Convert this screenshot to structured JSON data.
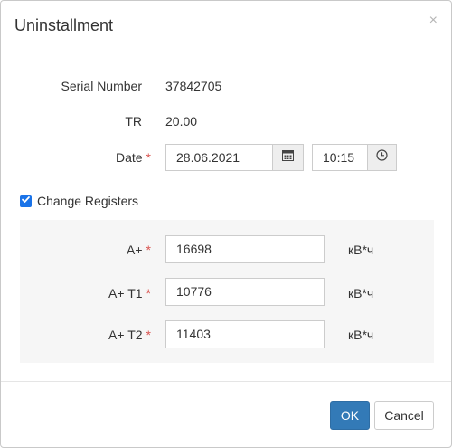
{
  "dialog": {
    "title": "Uninstallment",
    "close_glyph": "×"
  },
  "fields": {
    "serial_label": "Serial Number",
    "serial_value": "37842705",
    "tr_label": "TR",
    "tr_value": "20.00",
    "date_label": "Date",
    "date_value": "28.06.2021",
    "time_value": "10:15",
    "required_mark": "*"
  },
  "registers": {
    "checkbox_label": "Change Registers",
    "checked": true,
    "rows": [
      {
        "label": "A+",
        "value": "16698",
        "unit": "кВ*ч"
      },
      {
        "label": "A+ T1",
        "value": "10776",
        "unit": "кВ*ч"
      },
      {
        "label": "A+ T2",
        "value": "11403",
        "unit": "кВ*ч"
      }
    ]
  },
  "footer": {
    "ok_label": "OK",
    "cancel_label": "Cancel"
  },
  "colors": {
    "primary": "#337ab7",
    "required": "#d9534f",
    "checkbox": "#1a73e8"
  },
  "icons": {
    "calendar": "calendar-icon",
    "clock": "clock-icon",
    "close": "close-icon",
    "check": "checkmark-icon"
  }
}
